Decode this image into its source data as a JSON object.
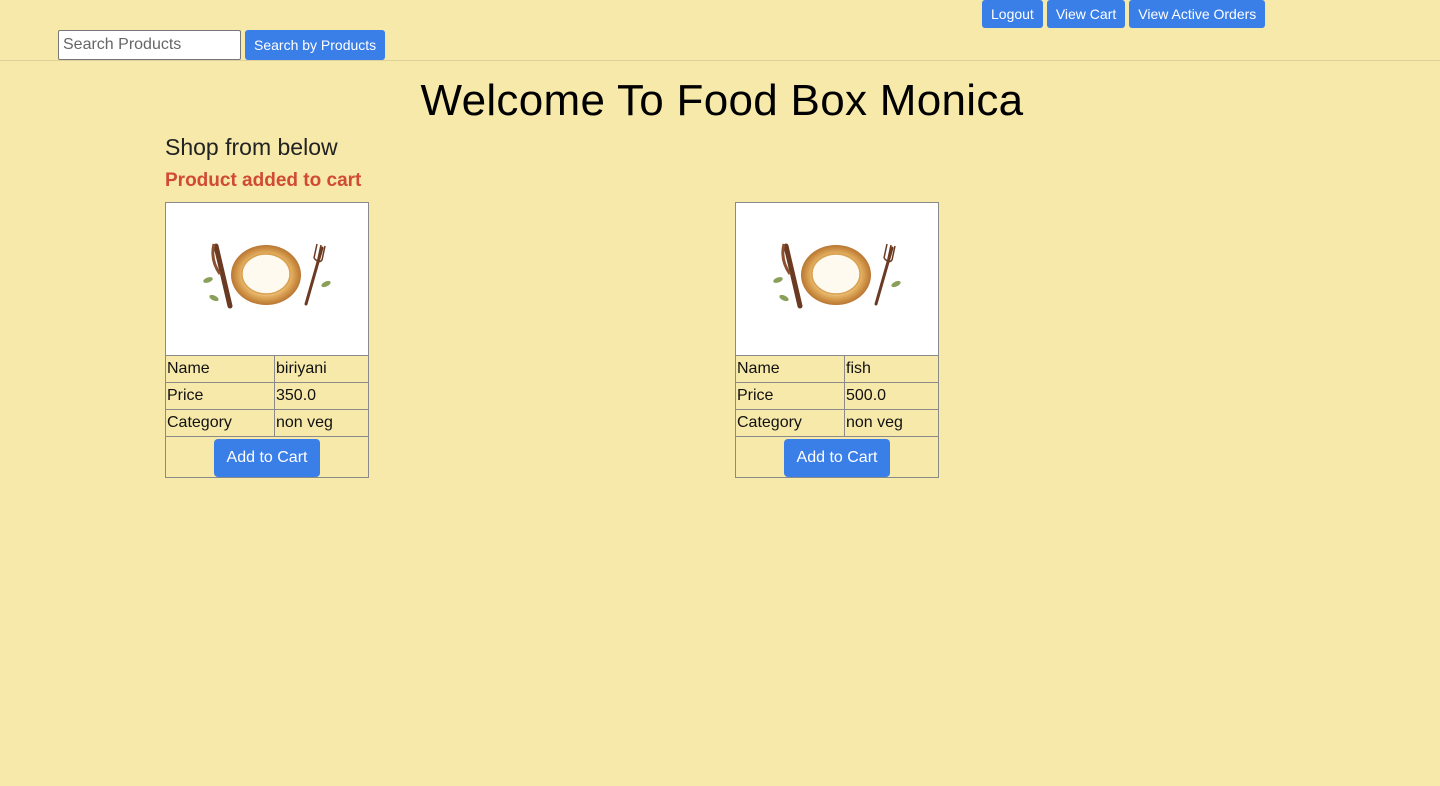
{
  "header": {
    "nav": {
      "logout_label": "Logout",
      "view_cart_label": "View Cart",
      "view_active_orders_label": "View Active Orders"
    },
    "search": {
      "placeholder": "Search Products",
      "value": "",
      "button_label": "Search by Products"
    }
  },
  "main": {
    "title": "Welcome To Food Box Monica",
    "subtitle": "Shop from below",
    "status_message": "Product added to cart",
    "products": [
      {
        "image_icon": "plate-cutlery-icon",
        "name_label": "Name",
        "name": "biriyani",
        "price_label": "Price",
        "price": "350.0",
        "category_label": "Category",
        "category": "non veg",
        "button_label": "Add to Cart"
      },
      {
        "image_icon": "plate-cutlery-icon",
        "name_label": "Name",
        "name": "fish",
        "price_label": "Price",
        "price": "500.0",
        "category_label": "Category",
        "category": "non veg",
        "button_label": "Add to Cart"
      }
    ]
  },
  "colors": {
    "background": "#f6e9a9",
    "button_blue": "#3a7ee8",
    "status_red": "#d04a34"
  }
}
